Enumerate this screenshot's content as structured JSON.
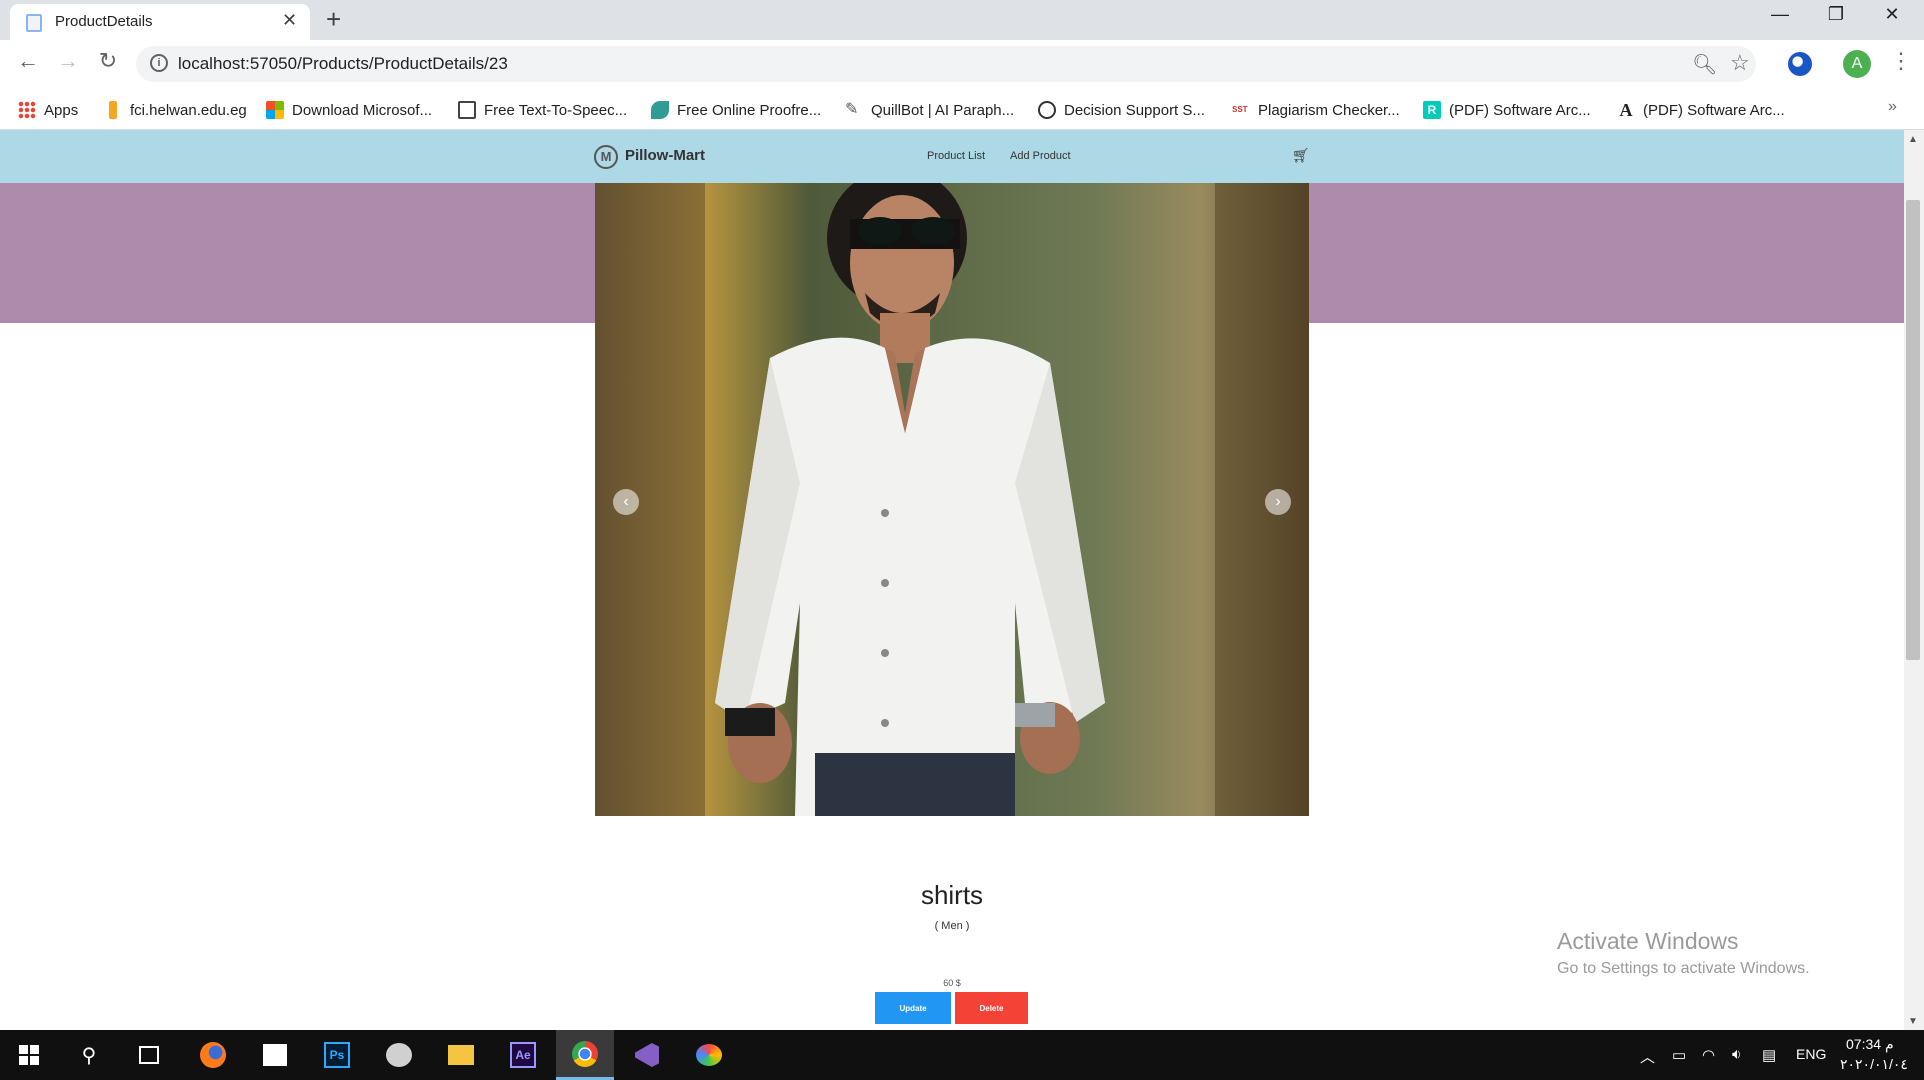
{
  "browser": {
    "tab_title": "ProductDetails",
    "url": "localhost:57050/Products/ProductDetails/23",
    "profile_initial": "A",
    "bookmarks": [
      {
        "label": "Apps",
        "icon": "apps-grid-icon",
        "color": "#ea4335"
      },
      {
        "label": "fci.helwan.edu.eg",
        "icon": "torch-icon",
        "color": "#f5a623"
      },
      {
        "label": "Download Microsof...",
        "icon": "microsoft-logo-icon",
        "color": "#f25022"
      },
      {
        "label": "Free Text-To-Speec...",
        "icon": "tts-icon",
        "color": "#444444"
      },
      {
        "label": "Free Online Proofre...",
        "icon": "proofread-icon",
        "color": "#2f9c95"
      },
      {
        "label": "QuillBot | AI Paraph...",
        "icon": "quill-icon",
        "color": "#555555"
      },
      {
        "label": "Decision Support S...",
        "icon": "decision-icon",
        "color": "#333333"
      },
      {
        "label": "Plagiarism Checker...",
        "icon": "sst-icon",
        "color": "#cc3333"
      },
      {
        "label": "(PDF) Software Arc...",
        "icon": "researchgate-icon",
        "color": "#00ccbb"
      },
      {
        "label": "(PDF) Software Arc...",
        "icon": "academia-icon",
        "color": "#000000"
      }
    ]
  },
  "site": {
    "brand": "Pillow-Mart",
    "brand_logo_letter": "M",
    "nav": {
      "product_list": "Product List",
      "add_product": "Add Product"
    }
  },
  "product": {
    "name": "shirts",
    "category": "( Men )",
    "price": "60 $",
    "update_label": "Update",
    "delete_label": "Delete"
  },
  "watermark": {
    "title": "Activate Windows",
    "subtitle": "Go to Settings to activate Windows."
  },
  "taskbar": {
    "lang": "ENG",
    "time": "07:34 م",
    "date": "٢٠٢٠/٠١/٠٤"
  },
  "colors": {
    "navbar": "#add8e6",
    "hero": "#ae8aad",
    "update": "#2196f3",
    "delete": "#f44336"
  }
}
